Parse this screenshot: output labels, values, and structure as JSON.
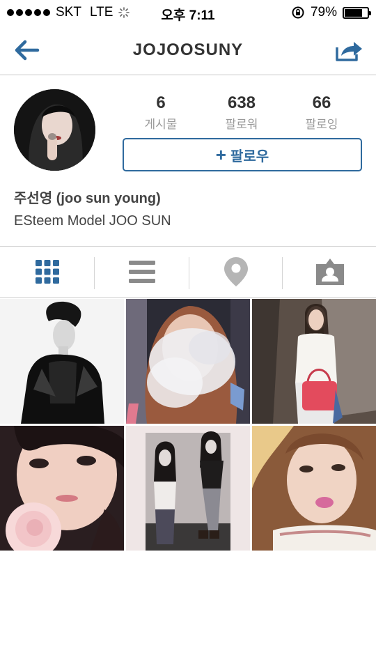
{
  "status_bar": {
    "carrier": "SKT",
    "network": "LTE",
    "time": "오후 7:11",
    "battery": "79%",
    "battery_level": 0.79
  },
  "nav": {
    "title": "JOJOOSUNY",
    "back_icon": "back-arrow-icon",
    "share_icon": "share-icon",
    "accent": "#2f6a9e"
  },
  "profile": {
    "stats": [
      {
        "value": "6",
        "label": "게시물"
      },
      {
        "value": "638",
        "label": "팔로워"
      },
      {
        "value": "66",
        "label": "팔로잉"
      }
    ],
    "follow_label": "팔로우",
    "follow_plus": "+",
    "name": "주선영 (joo sun young)",
    "bio": "ESteem Model JOO SUN"
  },
  "tabs": [
    {
      "icon": "grid-icon",
      "active": true
    },
    {
      "icon": "list-icon",
      "active": false
    },
    {
      "icon": "location-pin-icon",
      "active": false
    },
    {
      "icon": "tagged-person-icon",
      "active": false
    }
  ],
  "photos": [
    {
      "name": "photo-bw-model-leather-jacket"
    },
    {
      "name": "photo-smoke-face"
    },
    {
      "name": "photo-girl-red-bag"
    },
    {
      "name": "photo-girl-pink-rose"
    },
    {
      "name": "photo-two-models-bw"
    },
    {
      "name": "photo-girl-pink-lips"
    }
  ]
}
